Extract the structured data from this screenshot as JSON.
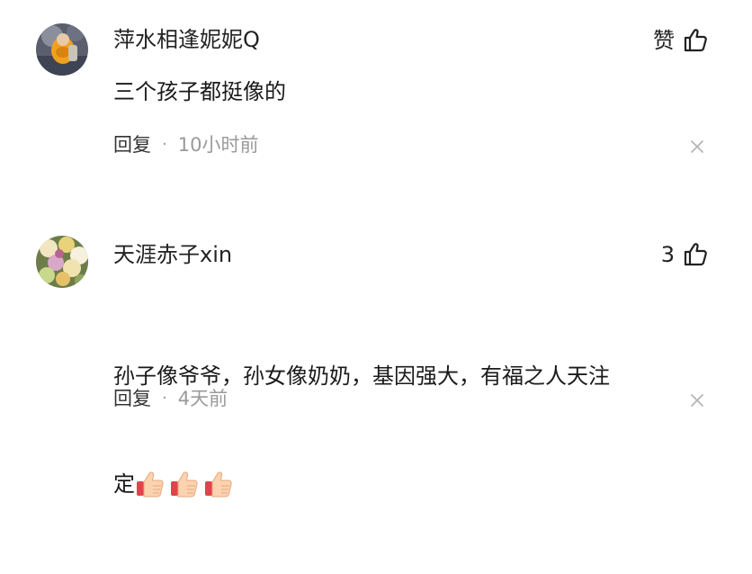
{
  "comments": [
    {
      "username": "萍水相逢妮妮Q",
      "like_label": "赞",
      "content": "三个孩子都挺像的",
      "reply_label": "回复",
      "separator": "·",
      "time": "10小时前",
      "avatar_icon": "avatar-icon",
      "like_icon": "thumbs-up-icon",
      "close_icon": "close-icon"
    },
    {
      "username": "天涯赤子xin",
      "like_label": "3",
      "content_line1": "孙子像爷爷，孙女像奶奶，基因强大，有福之人天注",
      "content_line2": "定",
      "emojis": [
        "thumbs-up-emoji",
        "thumbs-up-emoji",
        "thumbs-up-emoji"
      ],
      "reply_label": "回复",
      "separator": "·",
      "time": "4天前",
      "avatar_icon": "avatar-icon",
      "like_icon": "thumbs-up-icon",
      "close_icon": "close-icon"
    }
  ],
  "colors": {
    "text": "#222222",
    "muted": "#9a9a9a",
    "background": "#ffffff"
  }
}
